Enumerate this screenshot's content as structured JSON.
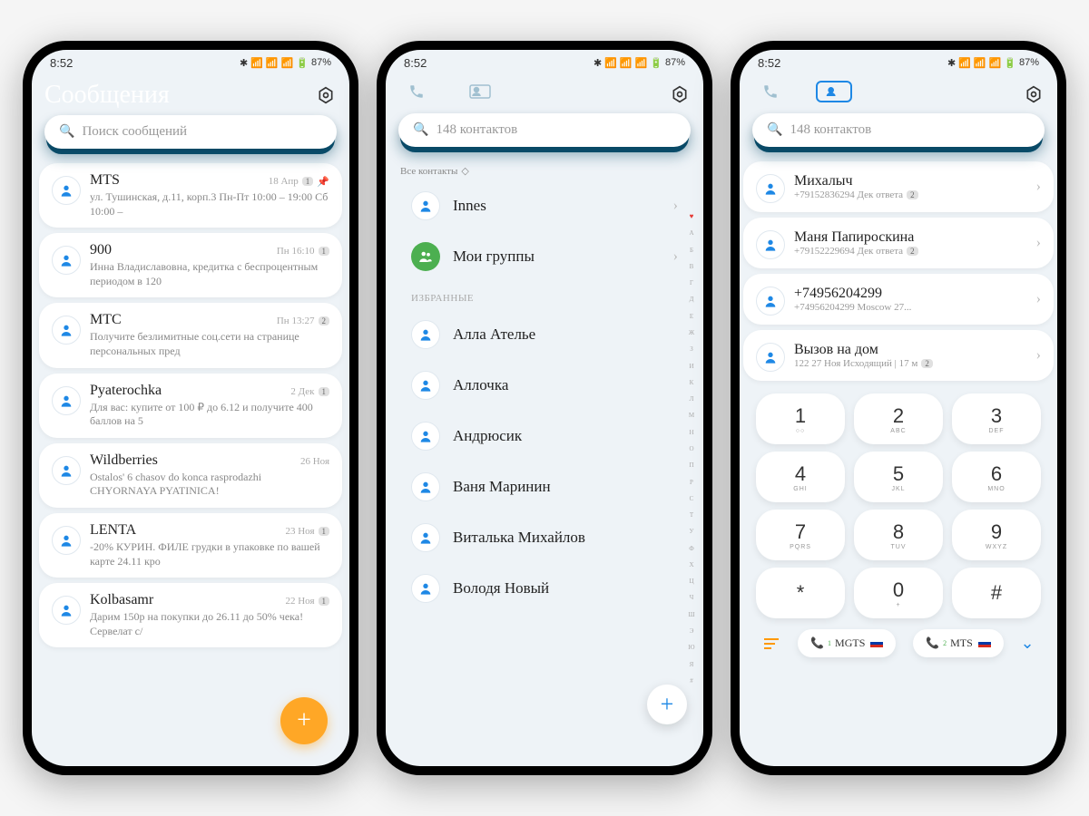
{
  "status": {
    "time": "8:52",
    "battery": "87%"
  },
  "settings_icon": "⬡",
  "phone1": {
    "title": "Сообщения",
    "search_placeholder": "Поиск сообщений",
    "messages": [
      {
        "sender": "MTS",
        "time": "18 Апр",
        "badge": "1",
        "pinned": true,
        "body": "ул. Тушинская, д.11, корп.3 Пн-Пт 10:00 – 19:00 Сб 10:00 –"
      },
      {
        "sender": "900",
        "time": "Пн 16:10",
        "badge": "1",
        "pinned": false,
        "body": "Инна Владиславовна, кредитка с беспроцентным периодом в 120"
      },
      {
        "sender": "МТС",
        "time": "Пн 13:27",
        "badge": "2",
        "pinned": false,
        "body": "Получите безлимитные соц.сети на странице персональных пред"
      },
      {
        "sender": "Pyaterochka",
        "time": "2 Дек",
        "badge": "1",
        "pinned": false,
        "body": "Для вас: купите от 100 ₽ до 6.12 и получите 400 баллов на 5"
      },
      {
        "sender": "Wildberries",
        "time": "26 Ноя",
        "badge": "",
        "pinned": false,
        "body": "Ostalos' 6 chasov do konca rasprodazhi CHYORNAYA PYATINICA!"
      },
      {
        "sender": "LENTA",
        "time": "23 Ноя",
        "badge": "1",
        "pinned": false,
        "body": "-20% КУРИН. ФИЛЕ грудки в упаковке по вашей карте 24.11 кро"
      },
      {
        "sender": "Kolbasamr",
        "time": "22 Ноя",
        "badge": "1",
        "pinned": false,
        "body": "Дарим 150р на покупки до 26.11 до 50% чека!Сервелат с/"
      }
    ]
  },
  "phone2": {
    "search_placeholder": "148 контактов",
    "filter": "Все контакты",
    "top_contact": "Innes",
    "groups": "Мои группы",
    "section": "ИЗБРАННЫЕ",
    "favorites": [
      "Алла Ателье",
      "Аллочка",
      "Андрюсик",
      "Ваня Маринин",
      "Виталька Михайлов",
      "Володя Новый"
    ],
    "index": [
      "♥",
      "A",
      "Б",
      "В",
      "Г",
      "Д",
      "Е",
      "Ж",
      "З",
      "И",
      "К",
      "Л",
      "М",
      "Н",
      "О",
      "П",
      "Р",
      "С",
      "Т",
      "У",
      "Ф",
      "Х",
      "Ц",
      "Ч",
      "Ш",
      "Э",
      "Ю",
      "Я",
      "#"
    ]
  },
  "phone3": {
    "search_placeholder": "148 контактов",
    "calls": [
      {
        "name": "Михалыч",
        "sub": "+79152836294 Дек ответа",
        "badge": "2"
      },
      {
        "name": "Маня Папироскина",
        "sub": "+79152229694 Дек ответа",
        "badge": "2"
      },
      {
        "name": "+74956204299",
        "sub": "+74956204299 Moscow 27..."
      },
      {
        "name": "Вызов на дом",
        "sub": "122 27 Ноя Исходящий | 17 м",
        "badge": "2"
      }
    ],
    "keys": [
      {
        "n": "1",
        "l": "○○"
      },
      {
        "n": "2",
        "l": "ABC"
      },
      {
        "n": "3",
        "l": "DEF"
      },
      {
        "n": "4",
        "l": "GHI"
      },
      {
        "n": "5",
        "l": "JKL"
      },
      {
        "n": "6",
        "l": "MNO"
      },
      {
        "n": "7",
        "l": "PQRS"
      },
      {
        "n": "8",
        "l": "TUV"
      },
      {
        "n": "9",
        "l": "WXYZ"
      },
      {
        "n": "*",
        "l": ""
      },
      {
        "n": "0",
        "l": "+"
      },
      {
        "n": "#",
        "l": ""
      }
    ],
    "sim1": "MGTS",
    "sim2": "MTS"
  }
}
